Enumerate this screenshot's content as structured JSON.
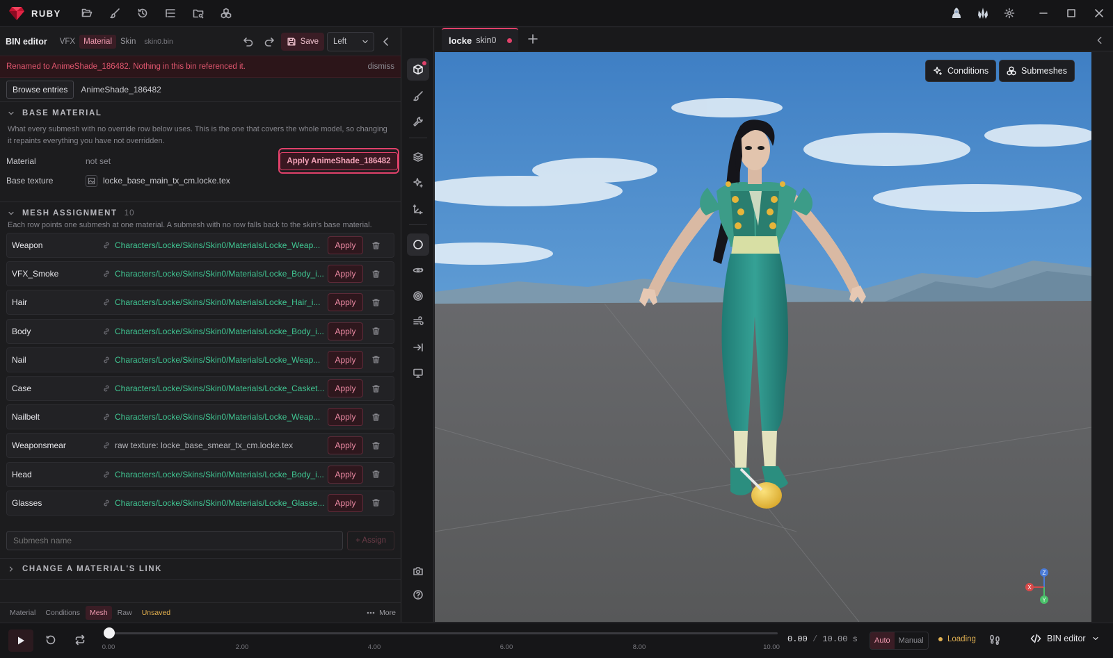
{
  "app": {
    "name": "RUBY"
  },
  "editor": {
    "title": "BIN editor",
    "tabs": [
      "VFX",
      "Material",
      "Skin"
    ],
    "active_tab": "Material",
    "file": "skin0.bin",
    "save_label": "Save",
    "side_select": "Left"
  },
  "banner": {
    "message": "Renamed to AnimeShade_186482. Nothing in this bin referenced it.",
    "dismiss": "dismiss"
  },
  "browse": {
    "button": "Browse entries",
    "entry": "AnimeShade_186482"
  },
  "base_material": {
    "heading": "BASE MATERIAL",
    "description": "What every submesh with no override row below uses. This is the one that covers the whole model, so changing it repaints everything you have not overridden.",
    "material_label": "Material",
    "material_value": "not set",
    "apply_label": "Apply AnimeShade_186482",
    "texture_label": "Base texture",
    "texture_value": "locke_base_main_tx_cm.locke.tex"
  },
  "mesh_assignment": {
    "heading": "MESH ASSIGNMENT",
    "count": "10",
    "description": "Each row points one submesh at one material. A submesh with no row falls back to the skin's base material.",
    "apply_label": "Apply",
    "rows": [
      {
        "name": "Weapon",
        "path": "Characters/Locke/Skins/Skin0/Materials/Locke_Weap..."
      },
      {
        "name": "VFX_Smoke",
        "path": "Characters/Locke/Skins/Skin0/Materials/Locke_Body_i..."
      },
      {
        "name": "Hair",
        "path": "Characters/Locke/Skins/Skin0/Materials/Locke_Hair_i..."
      },
      {
        "name": "Body",
        "path": "Characters/Locke/Skins/Skin0/Materials/Locke_Body_i..."
      },
      {
        "name": "Nail",
        "path": "Characters/Locke/Skins/Skin0/Materials/Locke_Weap..."
      },
      {
        "name": "Case",
        "path": "Characters/Locke/Skins/Skin0/Materials/Locke_Casket..."
      },
      {
        "name": "Nailbelt",
        "path": "Characters/Locke/Skins/Skin0/Materials/Locke_Weap..."
      },
      {
        "name": "Weaponsmear",
        "path": "raw texture: locke_base_smear_tx_cm.locke.tex"
      },
      {
        "name": "Head",
        "path": "Characters/Locke/Skins/Skin0/Materials/Locke_Body_i..."
      },
      {
        "name": "Glasses",
        "path": "Characters/Locke/Skins/Skin0/Materials/Locke_Glasse..."
      }
    ],
    "submesh_placeholder": "Submesh name",
    "assign_label": "+ Assign"
  },
  "change_link": {
    "heading": "CHANGE A MATERIAL'S LINK"
  },
  "bottom_tabs": {
    "items": [
      "Material",
      "Conditions",
      "Mesh",
      "Raw"
    ],
    "active": "Mesh",
    "unsaved": "Unsaved",
    "more": "More"
  },
  "viewport": {
    "tab_title": "locke",
    "tab_sub": "skin0",
    "conditions_label": "Conditions",
    "submeshes_label": "Submeshes",
    "axes": {
      "x": "X",
      "y": "Y",
      "z": "Z"
    }
  },
  "timeline": {
    "current": "0.00",
    "separator": "/",
    "duration": "10.00 s",
    "ticks": [
      "0.00",
      "2.00",
      "4.00",
      "6.00",
      "8.00",
      "10.00"
    ],
    "progress": 0,
    "mode_auto": "Auto",
    "mode_manual": "Manual",
    "status": "Loading",
    "bin_editor_label": "BIN editor"
  },
  "colors": {
    "accent": "#e0416a",
    "link_green": "#40c793",
    "warning": "#e0b052",
    "sky_top": "#3f7fc4",
    "ground": "#5e5f62"
  }
}
